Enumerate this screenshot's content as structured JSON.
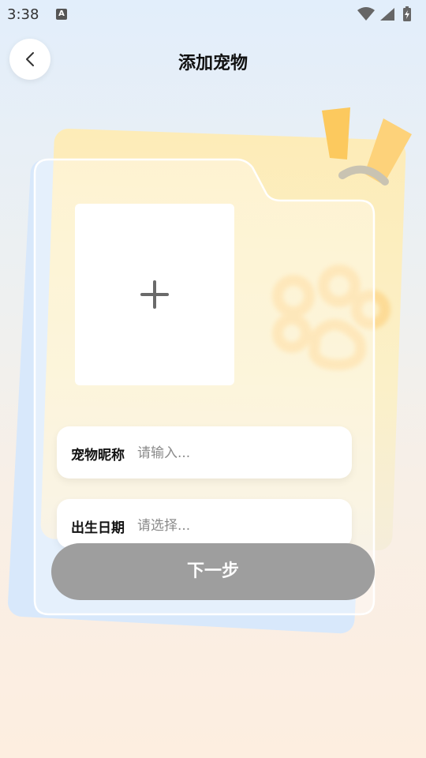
{
  "status_bar": {
    "time": "3:38",
    "notification_icon_letter": "A",
    "icons": [
      "wifi-icon",
      "signal-icon",
      "battery-charging-icon"
    ]
  },
  "header": {
    "back_icon": "chevron-left-icon",
    "title": "添加宠物"
  },
  "photo": {
    "add_icon": "plus-icon"
  },
  "form": {
    "nickname": {
      "label": "宠物昵称",
      "placeholder": "请输入...",
      "value": ""
    },
    "birthday": {
      "label": "出生日期",
      "placeholder": "请选择...",
      "value": ""
    }
  },
  "actions": {
    "next_label": "下一步",
    "next_color": "#9e9e9e"
  },
  "decor": {
    "paw_icon": "paw-print-icon",
    "spark_color": "#ffd27a"
  }
}
